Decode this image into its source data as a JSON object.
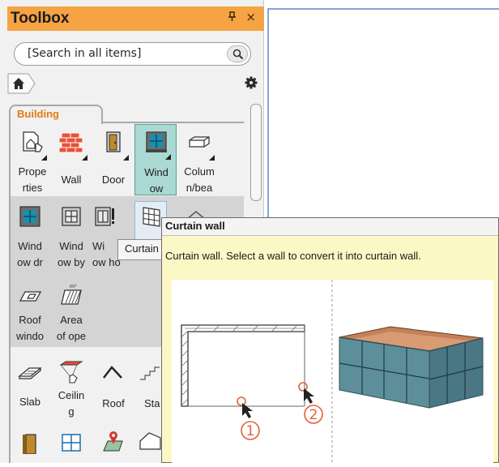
{
  "toolbox": {
    "title": "Toolbox",
    "pin_icon": "pin-icon",
    "close_label": "×",
    "search": {
      "placeholder": "[Search in all items]"
    },
    "tab": "Building",
    "tools_row1": [
      {
        "label": "Prope\nrties",
        "icon": "properties-icon"
      },
      {
        "label": "Wall",
        "icon": "wall-icon"
      },
      {
        "label": "Door",
        "icon": "door-icon"
      },
      {
        "label": "Wind\now",
        "icon": "window-icon"
      },
      {
        "label": "Colum\nn/bea",
        "icon": "column-icon"
      }
    ],
    "tools_row2": [
      {
        "label": "Wind\now dr",
        "icon": "window-draw-icon"
      },
      {
        "label": "Wind\now by",
        "icon": "window-by-icon"
      },
      {
        "label": "Wi\now ho",
        "icon": "window-hole-icon"
      },
      {
        "label": "",
        "icon": "curtain-wall-icon"
      }
    ],
    "tools_row3": [
      {
        "label": "Roof\nwindo",
        "icon": "roof-window-icon"
      },
      {
        "label": "Area\nof ope",
        "icon": "area-opening-icon"
      }
    ],
    "tools_row4": [
      {
        "label": "Slab",
        "icon": "slab-icon"
      },
      {
        "label": "Ceilin\ng",
        "icon": "ceiling-icon"
      },
      {
        "label": "Roof",
        "icon": "roof-icon"
      },
      {
        "label": "Sta",
        "icon": "stairs-icon"
      }
    ]
  },
  "small_tooltip": "Curtain",
  "tooltip": {
    "title": "Curtain wall",
    "description": "Curtain wall. Select a wall to convert it into curtain wall.",
    "step1": "1",
    "step2": "2"
  },
  "colors": {
    "header": "#f5a343",
    "tab_label": "#e07a14",
    "selected_tool": "#a9d9d2",
    "tooltip_bg": "#fbf8c6",
    "step_marker": "#e0623a"
  }
}
